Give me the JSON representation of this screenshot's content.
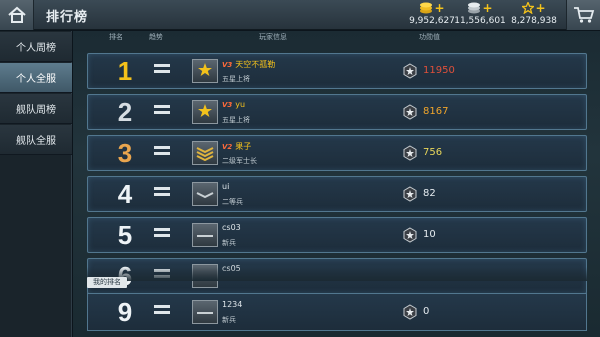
{
  "header": {
    "title": "排行榜",
    "home_icon": "home-icon",
    "cart_icon": "cart-icon",
    "currencies": [
      {
        "name": "gold-coins",
        "value": "9,952,627",
        "icon": "coins-icon"
      },
      {
        "name": "silver",
        "value": "11,556,601",
        "icon": "silver-icon"
      },
      {
        "name": "stars",
        "value": "8,278,938",
        "icon": "star-icon"
      }
    ]
  },
  "sidebar": {
    "items": [
      {
        "label": "个人周榜",
        "active": false
      },
      {
        "label": "个人全服",
        "active": true
      },
      {
        "label": "舰队周榜",
        "active": false
      },
      {
        "label": "舰队全服",
        "active": false
      }
    ]
  },
  "table": {
    "headers": {
      "rank": "排名",
      "trend": "趋势",
      "player": "玩家信息",
      "merit": "功勋值"
    },
    "rows": [
      {
        "rank": "1",
        "vip": "V3",
        "name": "天空不孤勒",
        "title": "五星上将",
        "merit": "11950"
      },
      {
        "rank": "2",
        "vip": "V3",
        "name": "yu",
        "title": "五星上将",
        "merit": "8167"
      },
      {
        "rank": "3",
        "vip": "V2",
        "name": "果子",
        "title": "二级军士长",
        "merit": "756"
      },
      {
        "rank": "4",
        "vip": "",
        "name": "ui",
        "title": "二等兵",
        "merit": "82"
      },
      {
        "rank": "5",
        "vip": "",
        "name": "cs03",
        "title": "新兵",
        "merit": "10"
      },
      {
        "rank": "6",
        "vip": "",
        "name": "cs05",
        "title": "",
        "merit": ""
      }
    ]
  },
  "my_rank": {
    "tag": "我的排名",
    "rank": "9",
    "name": "1234",
    "title": "新兵",
    "merit": "0"
  },
  "colors": {
    "gold": "#f5c21b",
    "accent_border": "#52778f",
    "merit_first": "#e0503b",
    "merit_second": "#f0a52b"
  }
}
